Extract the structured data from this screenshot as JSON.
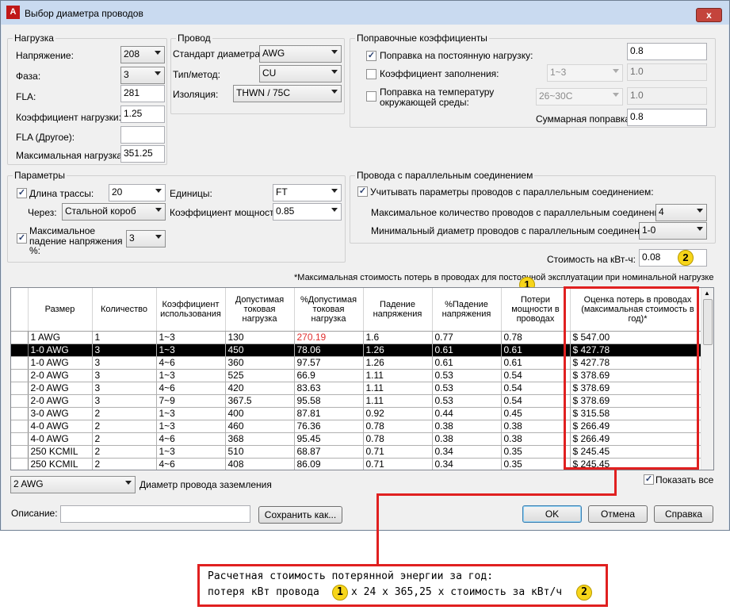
{
  "window": {
    "title": "Выбор диаметра проводов",
    "close_label": "x",
    "app_icon_letter": "A"
  },
  "load": {
    "legend": "Нагрузка",
    "voltage_label": "Напряжение:",
    "voltage": "208",
    "phase_label": "Фаза:",
    "phase": "3",
    "fla_label": "FLA:",
    "fla": "281",
    "load_factor_label": "Коэффициент нагрузки:",
    "load_factor": "1.25",
    "fla_other_label": "FLA (Другое):",
    "fla_other": "",
    "max_load_label": "Максимальная нагрузка:",
    "max_load": "351.25"
  },
  "wire": {
    "legend": "Провод",
    "standard_label": "Стандарт диаметра:",
    "standard": "AWG",
    "type_label": "Тип/метод:",
    "type": "CU",
    "insulation_label": "Изоляция:",
    "insulation": "THWN / 75C"
  },
  "correction": {
    "legend": "Поправочные коэффициенты",
    "continuous_label": "Поправка на постоянную нагрузку:",
    "continuous_checked": "✓",
    "continuous_value": "0.8",
    "fill_label": "Коэффициент заполнения:",
    "fill_range": "1~3",
    "fill_value": "1.0",
    "temp_label_1": "Поправка на температуру",
    "temp_label_2": "окружающей среды:",
    "temp_range": "26~30C",
    "temp_value": "1.0",
    "total_label": "Суммарная поправка:",
    "total_value": "0.8"
  },
  "params": {
    "legend": "Параметры",
    "run_length_label": "Длина трассы:",
    "run_length_checked": "✓",
    "run_length": "20",
    "units_label": "Единицы:",
    "units": "FT",
    "via_label": "Через:",
    "via": "Стальной короб",
    "power_factor_label": "Коэффициент мощности:",
    "power_factor": "0.85",
    "max_drop_label_1": "Максимальное",
    "max_drop_label_2": "падение напряжения",
    "max_drop_label_3": "%:",
    "max_drop_checked": "✓",
    "max_drop": "3"
  },
  "parallel": {
    "legend": "Провода с параллельным соединением",
    "consider_label": "Учитывать параметры проводов с параллельным соединением:",
    "consider_checked": "✓",
    "max_count_label": "Максимальное количество проводов с параллельным соединением:",
    "max_count": "4",
    "min_size_label": "Минимальный диаметр проводов с параллельным соединением:",
    "min_size": "1-0"
  },
  "cost": {
    "label": "Стоимость на кВт-ч:",
    "value": "0.08"
  },
  "note": "*Максимальная стоимость потерь в проводах для постоянной эксплуатации при номинальной нагрузке",
  "table": {
    "headers": [
      "Размер",
      "Количество",
      "Коэффициент использования",
      "Допустимая токовая нагрузка",
      "%Допустимая токовая нагрузка",
      "Падение напряжения",
      "%Падение напряжения",
      "Потери мощности в проводах",
      "Оценка потерь в проводах (максимальная стоимость в год)*"
    ],
    "rows": [
      [
        "1 AWG",
        "1",
        "1~3",
        "130",
        "270.19",
        "1.6",
        "0.77",
        "0.78",
        "$ 547.00"
      ],
      [
        "1-0 AWG",
        "3",
        "1~3",
        "450",
        "78.06",
        "1.26",
        "0.61",
        "0.61",
        "$ 427.78"
      ],
      [
        "1-0 AWG",
        "3",
        "4~6",
        "360",
        "97.57",
        "1.26",
        "0.61",
        "0.61",
        "$ 427.78"
      ],
      [
        "2-0 AWG",
        "3",
        "1~3",
        "525",
        "66.9",
        "1.11",
        "0.53",
        "0.54",
        "$ 378.69"
      ],
      [
        "2-0 AWG",
        "3",
        "4~6",
        "420",
        "83.63",
        "1.11",
        "0.53",
        "0.54",
        "$ 378.69"
      ],
      [
        "2-0 AWG",
        "3",
        "7~9",
        "367.5",
        "95.58",
        "1.11",
        "0.53",
        "0.54",
        "$ 378.69"
      ],
      [
        "3-0 AWG",
        "2",
        "1~3",
        "400",
        "87.81",
        "0.92",
        "0.44",
        "0.45",
        "$ 315.58"
      ],
      [
        "4-0 AWG",
        "2",
        "1~3",
        "460",
        "76.36",
        "0.78",
        "0.38",
        "0.38",
        "$ 266.49"
      ],
      [
        "4-0 AWG",
        "2",
        "4~6",
        "368",
        "95.45",
        "0.78",
        "0.38",
        "0.38",
        "$ 266.49"
      ],
      [
        "250 KCMIL",
        "2",
        "1~3",
        "510",
        "68.87",
        "0.71",
        "0.34",
        "0.35",
        "$ 245.45"
      ],
      [
        "250 KCMIL",
        "2",
        "4~6",
        "408",
        "86.09",
        "0.71",
        "0.34",
        "0.35",
        "$ 245.45"
      ]
    ],
    "selected_row": 1
  },
  "ground": {
    "value": "2 AWG",
    "label": "Диаметр провода заземления"
  },
  "show_all": {
    "label": "Показать все",
    "checked": "✓"
  },
  "description": {
    "label": "Описание:",
    "value": ""
  },
  "buttons": {
    "save_as": "Сохранить как...",
    "ok": "OK",
    "cancel": "Отмена",
    "help": "Справка"
  },
  "badges": {
    "one": "1",
    "two": "2"
  },
  "callout": {
    "line1": "Расчетная стоимость потерянной энергии за год:",
    "line2_a": "потеря кВт провода",
    "line2_b": "x 24 x 365,25 x стоимость за кВт/ч"
  },
  "colors": {
    "highlight": "#e02020",
    "badge": "#f7d51a",
    "over_limit_text": "#e03030"
  }
}
